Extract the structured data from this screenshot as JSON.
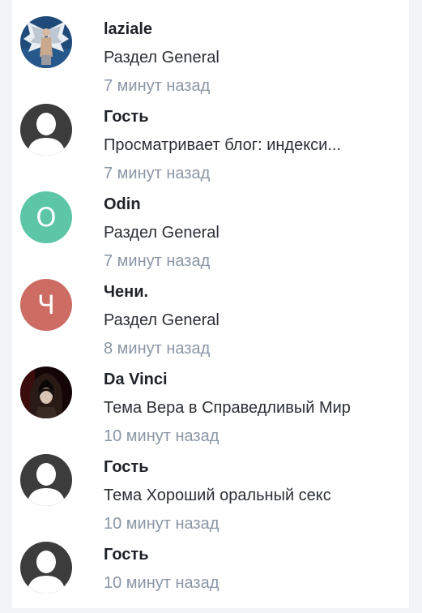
{
  "colors": {
    "odin_avatar": "#5cc6a7",
    "cheni_avatar": "#cc6c63",
    "guest_avatar": "#3c3c3c",
    "time_text": "#8a96a5"
  },
  "entries": [
    {
      "name": "laziale",
      "activity": "Раздел General",
      "time": "7 минут назад",
      "avatar": "angel-image-icon"
    },
    {
      "name": "Гость",
      "activity": "Просматривает блог: индекси...",
      "time": "7 минут назад",
      "avatar": "default-user-icon"
    },
    {
      "name": "Odin",
      "activity": "Раздел General",
      "time": "7 минут назад",
      "avatar_letter": "O"
    },
    {
      "name": "Чени.",
      "activity": "Раздел General",
      "time": "8 минут назад",
      "avatar_letter": "Ч"
    },
    {
      "name": "Da Vinci",
      "activity": "Тема Вера в Справедливый Мир",
      "time": "10 минут назад",
      "avatar": "hooded-figure-image-icon"
    },
    {
      "name": "Гость",
      "activity": "Тема Хороший оральный секс",
      "time": "10 минут назад",
      "avatar": "default-user-icon"
    },
    {
      "name": "Гость",
      "time": "10 минут назад",
      "avatar": "default-user-icon"
    }
  ]
}
